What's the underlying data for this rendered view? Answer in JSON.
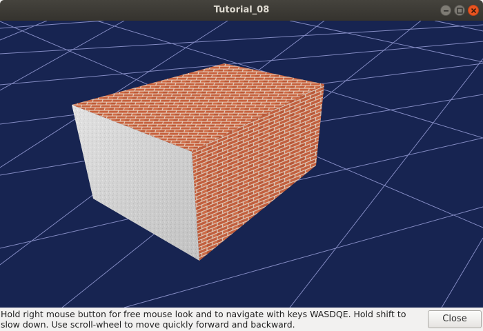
{
  "window": {
    "title": "Tutorial_08"
  },
  "scene": {
    "background_color": "#172451",
    "grid_color": "#8f96cf",
    "box": {
      "top_texture": "brick",
      "right_face_texture": "brick",
      "left_face_texture": "plaster",
      "brick_color": "#c8623d",
      "mortar_color": "#e9d6c7",
      "plaster_color": "#dcdcdc"
    }
  },
  "footer": {
    "help_text": "Hold right mouse button for free mouse look and to navigate with keys WASDQE. Hold shift to slow down. Use scroll-wheel to move quickly forward and backward.",
    "close_label": "Close"
  }
}
